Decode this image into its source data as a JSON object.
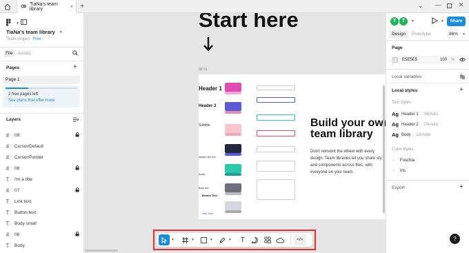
{
  "titlebar": {
    "tab_label": "TiaNa's team library"
  },
  "left": {
    "team_name": "TiaNa's team library",
    "team_project": "Team project",
    "plan_badge": "Free",
    "tabs": [
      "File",
      "Assets"
    ],
    "pages_heading": "Pages",
    "page_item": "Page 1",
    "free_pages_text": "2 free pages left.",
    "see_plans": "See plans that offer more",
    "layers_heading": "Layers",
    "layers": [
      {
        "icon": "#",
        "label": "09",
        "locked": true
      },
      {
        "icon": "#",
        "label": "Cursor/Default",
        "locked": false
      },
      {
        "icon": "#",
        "label": "Cursor/Pointer",
        "locked": false
      },
      {
        "icon": "#",
        "label": "08",
        "locked": true
      },
      {
        "icon": "T",
        "label": "I'm a title",
        "locked": false
      },
      {
        "icon": "#",
        "label": "07",
        "locked": true
      },
      {
        "icon": "T",
        "label": "Link text",
        "locked": false
      },
      {
        "icon": "T",
        "label": "Button text",
        "locked": false
      },
      {
        "icon": "T",
        "label": "Body small",
        "locked": false
      },
      {
        "icon": "#",
        "label": "06",
        "locked": true
      },
      {
        "icon": "T",
        "label": "Body",
        "locked": false
      }
    ]
  },
  "canvas": {
    "heading": "Start here",
    "frame_label": "02 01",
    "build_title_1": "Build your own",
    "build_title_2": "team library",
    "build_body_lines": [
      "Don't reinvent the wheel with every",
      "design. Team libraries let you share sty",
      "and components across files, with",
      "everyone on your team."
    ],
    "left_labels": [
      "Header 1",
      "Header 3",
      "Subtitle",
      "Header title text",
      "Body",
      "Body text",
      "Button Text",
      "Link Text"
    ]
  },
  "right": {
    "avatar_initial": "T",
    "share_label": "Share",
    "tabs": [
      "Design",
      "Prototype"
    ],
    "zoom": "86%",
    "page_heading": "Page",
    "page_color": "E5E5E5",
    "page_opacity": "100",
    "page_pct": "%",
    "local_variables": "Local variables",
    "local_styles": "Local styles",
    "text_styles": "Text styles",
    "text_style_items": [
      {
        "name": "Header 1",
        "detail": "· 34/Auto"
      },
      {
        "name": "Header 2",
        "detail": "· 20/Auto"
      },
      {
        "name": "Body",
        "detail": "· 13/Auto"
      }
    ],
    "color_styles": "Color styles",
    "color_items": [
      "Fuschia",
      "Iris"
    ],
    "export": "Export",
    "help": "?"
  },
  "colors": {
    "accent": "#1a8cdb",
    "highlight": "#e03030",
    "canvas": "#e5e5e5"
  }
}
